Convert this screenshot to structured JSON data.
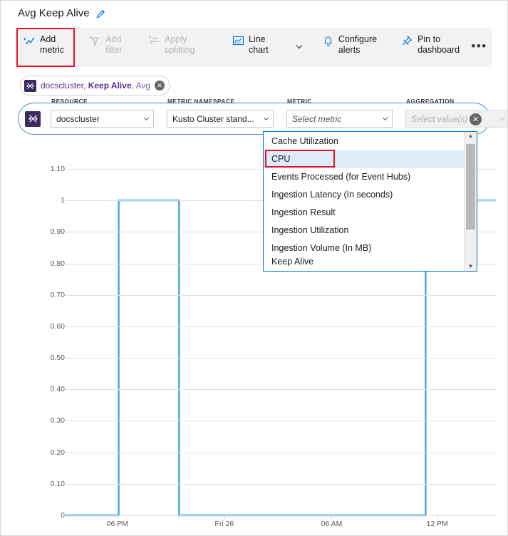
{
  "header": {
    "title": "Avg Keep Alive",
    "edit_icon": "pencil-icon"
  },
  "toolbar": {
    "items": [
      {
        "label": "Add metric",
        "icon": "add-metric-icon",
        "disabled": false,
        "highlighted": true
      },
      {
        "label": "Add filter",
        "icon": "add-filter-icon",
        "disabled": true,
        "highlighted": false
      },
      {
        "label": "Apply splitting",
        "icon": "apply-splitting-icon",
        "disabled": true,
        "highlighted": false
      },
      {
        "label": "Line chart",
        "icon": "line-chart-icon",
        "disabled": false,
        "highlighted": false
      },
      {
        "label": "Configure alerts",
        "icon": "bell-icon",
        "disabled": false,
        "highlighted": false
      },
      {
        "label": "Pin to dashboard",
        "icon": "pin-icon",
        "disabled": false,
        "highlighted": false
      }
    ],
    "chevron_icon": "chevron-down-icon",
    "more_label": "•••"
  },
  "chip": {
    "resource": "docscluster, ",
    "metric": "Keep Alive",
    "aggregation": ", Avg",
    "icon": "metric-chip-icon",
    "close_label": "✕"
  },
  "metric_row": {
    "icon": "metric-row-icon",
    "close_label": "✕",
    "fields": [
      {
        "label": "RESOURCE",
        "value": "docscluster",
        "placeholder": "",
        "disabled": false,
        "italic": false
      },
      {
        "label": "METRIC NAMESPACE",
        "value": "Kusto Cluster stand...",
        "placeholder": "",
        "disabled": false,
        "italic": false
      },
      {
        "label": "METRIC",
        "value": "Select metric",
        "placeholder": "Select metric",
        "disabled": false,
        "italic": true
      },
      {
        "label": "AGGREGATION",
        "value": "Select value(s)",
        "placeholder": "Select value(s)",
        "disabled": true,
        "italic": true
      }
    ]
  },
  "dropdown": {
    "selected": "CPU",
    "highlight_color": "#e81123",
    "items": [
      {
        "label": "Cache Utilization",
        "selected": false,
        "clipped": false
      },
      {
        "label": "CPU",
        "selected": true,
        "clipped": false
      },
      {
        "label": "Events Processed (for Event Hubs)",
        "selected": false,
        "clipped": false
      },
      {
        "label": "Ingestion Latency (In seconds)",
        "selected": false,
        "clipped": false
      },
      {
        "label": "Ingestion Result",
        "selected": false,
        "clipped": false
      },
      {
        "label": "Ingestion Utilization",
        "selected": false,
        "clipped": false
      },
      {
        "label": "Ingestion Volume (In MB)",
        "selected": false,
        "clipped": false
      },
      {
        "label": "Keep Alive",
        "selected": false,
        "clipped": true
      }
    ],
    "scroll_up_icon": "scroll-up-arrow-icon",
    "scroll_down_icon": "scroll-down-arrow-icon"
  },
  "chart_data": {
    "type": "line",
    "title": "Avg Keep Alive",
    "xlabel": "",
    "ylabel": "",
    "series_name": "Keep Alive (Avg)",
    "line_color": "#40a8e8",
    "grid": true,
    "legend": "none",
    "ylim": [
      0,
      1.1
    ],
    "yticks": [
      "0",
      "0.10",
      "0.20",
      "0.30",
      "0.40",
      "0.50",
      "0.60",
      "0.70",
      "0.80",
      "0.90",
      "1",
      "1.10"
    ],
    "ytick_values": [
      0,
      0.1,
      0.2,
      0.3,
      0.4,
      0.5,
      0.6,
      0.7,
      0.8,
      0.9,
      1.0,
      1.1
    ],
    "xticks": [
      "06 PM",
      "Fri 26",
      "06 AM",
      "12 PM"
    ],
    "xtick_fractions": [
      0.122,
      0.37,
      0.619,
      0.864
    ],
    "x": [
      0.0,
      0.125,
      0.125,
      0.265,
      0.265,
      0.837,
      0.837,
      1.0
    ],
    "y": [
      0,
      0,
      1,
      1,
      0,
      0,
      1,
      1
    ],
    "description": "Step pulses: value 1 between 06 PM-ish and Fri 26, 0 elsewhere, rising again to 1 after 12 PM"
  }
}
